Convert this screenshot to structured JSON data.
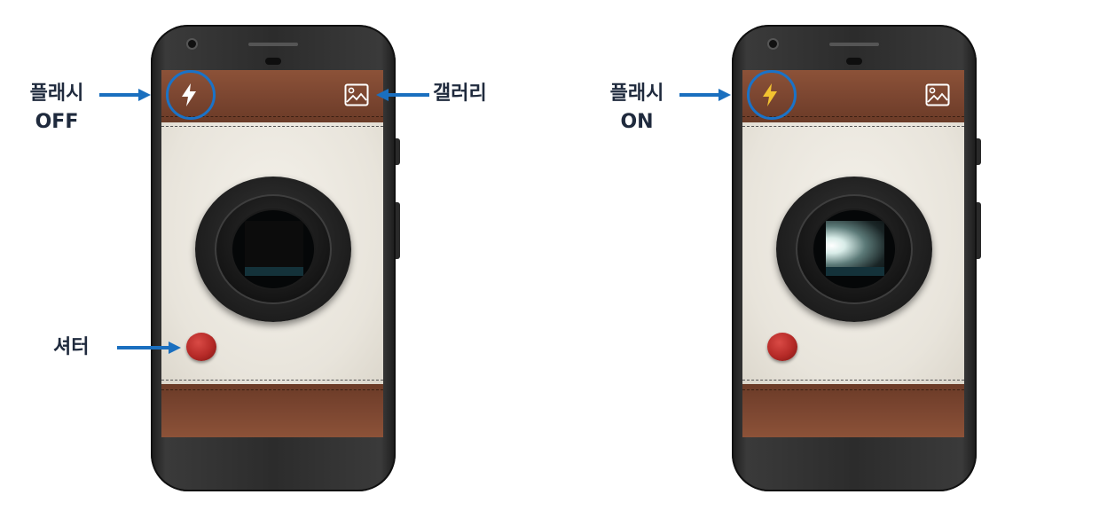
{
  "phone_off": {
    "flash_icon": "flash-off-icon",
    "gallery_icon": "gallery-icon",
    "flash_color": "#ffffff"
  },
  "phone_on": {
    "flash_icon": "flash-on-icon",
    "gallery_icon": "gallery-icon",
    "flash_color": "#f2c230"
  },
  "callouts": {
    "flash_off": {
      "line1": "플래시",
      "line2": "OFF"
    },
    "gallery": {
      "label": "갤러리"
    },
    "shutter": {
      "label": "셔터"
    },
    "flash_on": {
      "line1": "플래시",
      "line2": "ON"
    }
  },
  "colors": {
    "highlight": "#1a73c8",
    "arrow": "#1a6fbf",
    "text": "#1f2a3d"
  }
}
